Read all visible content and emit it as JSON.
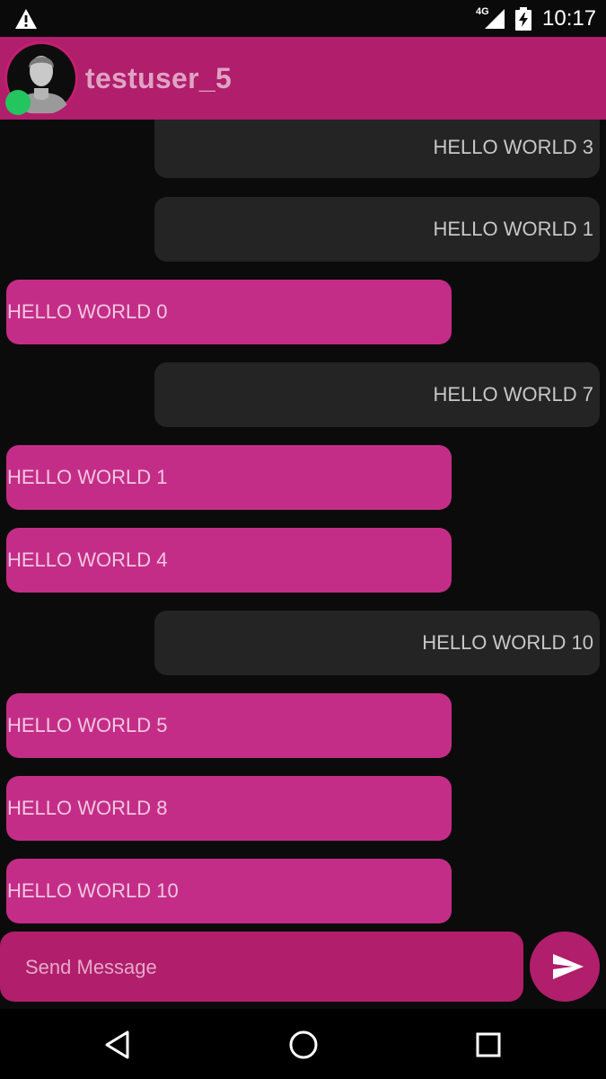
{
  "status_bar": {
    "network": "4G",
    "time": "10:17"
  },
  "header": {
    "username": "testuser_5",
    "online_color": "#22c55e"
  },
  "messages": [
    {
      "text": "HELLO WORLD 3",
      "direction": "incoming"
    },
    {
      "text": "HELLO WORLD 1",
      "direction": "incoming"
    },
    {
      "text": "HELLO WORLD 0",
      "direction": "outgoing"
    },
    {
      "text": "HELLO WORLD 7",
      "direction": "incoming"
    },
    {
      "text": "HELLO WORLD 1",
      "direction": "outgoing"
    },
    {
      "text": "HELLO WORLD 4",
      "direction": "outgoing"
    },
    {
      "text": "HELLO WORLD 10",
      "direction": "incoming"
    },
    {
      "text": "HELLO WORLD 5",
      "direction": "outgoing"
    },
    {
      "text": "HELLO WORLD 8",
      "direction": "outgoing"
    },
    {
      "text": "HELLO WORLD 10",
      "direction": "outgoing"
    }
  ],
  "composer": {
    "placeholder": "Send Message",
    "value": ""
  },
  "colors": {
    "accent": "#b01e6c",
    "outgoing_bubble": "#c42d87",
    "incoming_bubble": "#242424",
    "background": "#0b0b0b"
  },
  "icons": {
    "status": [
      "warning-icon",
      "signal-icon",
      "battery-charging-icon"
    ],
    "composer": [
      "send-icon"
    ],
    "navigation": [
      "back-icon",
      "home-icon",
      "recents-icon"
    ]
  }
}
